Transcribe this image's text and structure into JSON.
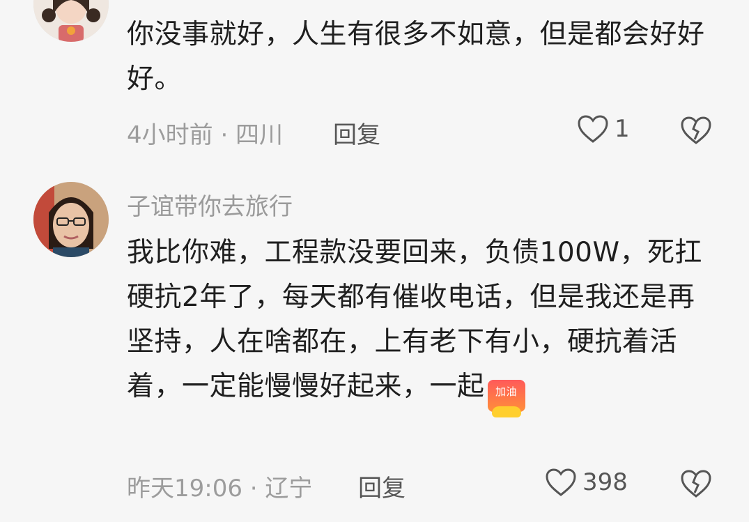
{
  "comments": [
    {
      "username": "",
      "text": "你没事就好，人生有很多不如意，但是都会好好好。",
      "time_location": "4小时前 · 四川",
      "reply_label": "回复",
      "likes": "1",
      "avatar_icon": "avatar-girl-cartoon"
    },
    {
      "username": "子谊带你去旅行",
      "text": "我比你难，工程款没要回来，负债100W，死扛硬抗2年了，每天都有催收电话，但是我还是再坚持，人在啥都在，上有老下有小，硬抗着活着，一定能慢慢好起来，一起",
      "emoji_label": "加油",
      "time_location": "昨天19:06 · 辽宁",
      "reply_label": "回复",
      "likes": "398",
      "avatar_icon": "avatar-woman-glasses"
    }
  ],
  "colors": {
    "background": "#f6f6f6",
    "text": "#1f1f1f",
    "meta": "#9c9c9c",
    "icon": "#555555"
  }
}
